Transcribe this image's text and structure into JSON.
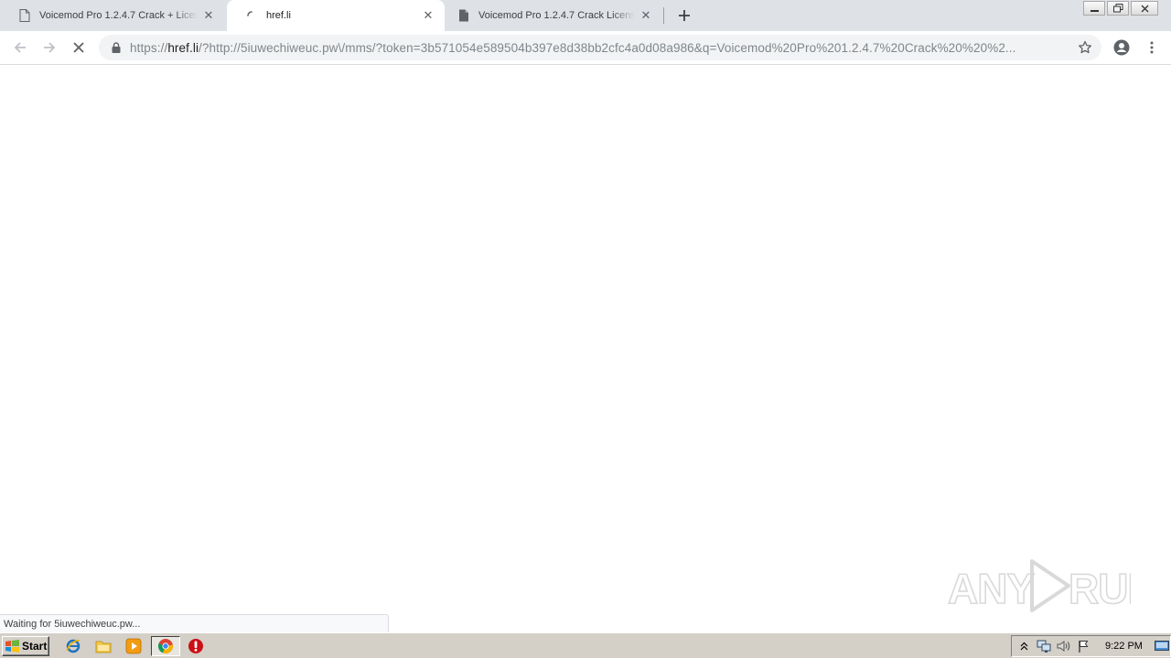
{
  "tabs": [
    {
      "title": "Voicemod Pro 1.2.4.7 Crack + License Key",
      "favicon": "document-icon",
      "active": false
    },
    {
      "title": "href.li",
      "favicon": "loading-spinner-icon",
      "active": true
    },
    {
      "title": "Voicemod Pro 1.2.4.7 Crack License Key",
      "favicon": "file-icon",
      "active": false
    }
  ],
  "toolbar": {
    "url_scheme": "https://",
    "url_host": "href.li",
    "url_rest": "/?http://5iuwechiweuc.pw\\/mms/?token=3b571054e589504b397e8d38bb2cfc4a0d08a986&q=Voicemod%20Pro%201.2.4.7%20Crack%20%20%2..."
  },
  "status": {
    "text": "Waiting for 5iuwechiweuc.pw..."
  },
  "watermark": {
    "text": "ANY RUN"
  },
  "taskbar": {
    "start_label": "Start",
    "clock": "9:22 PM"
  },
  "colors": {
    "tabstrip": "#dee1e6",
    "omnibox": "#f1f3f4",
    "taskbar": "#d4d0c8"
  }
}
